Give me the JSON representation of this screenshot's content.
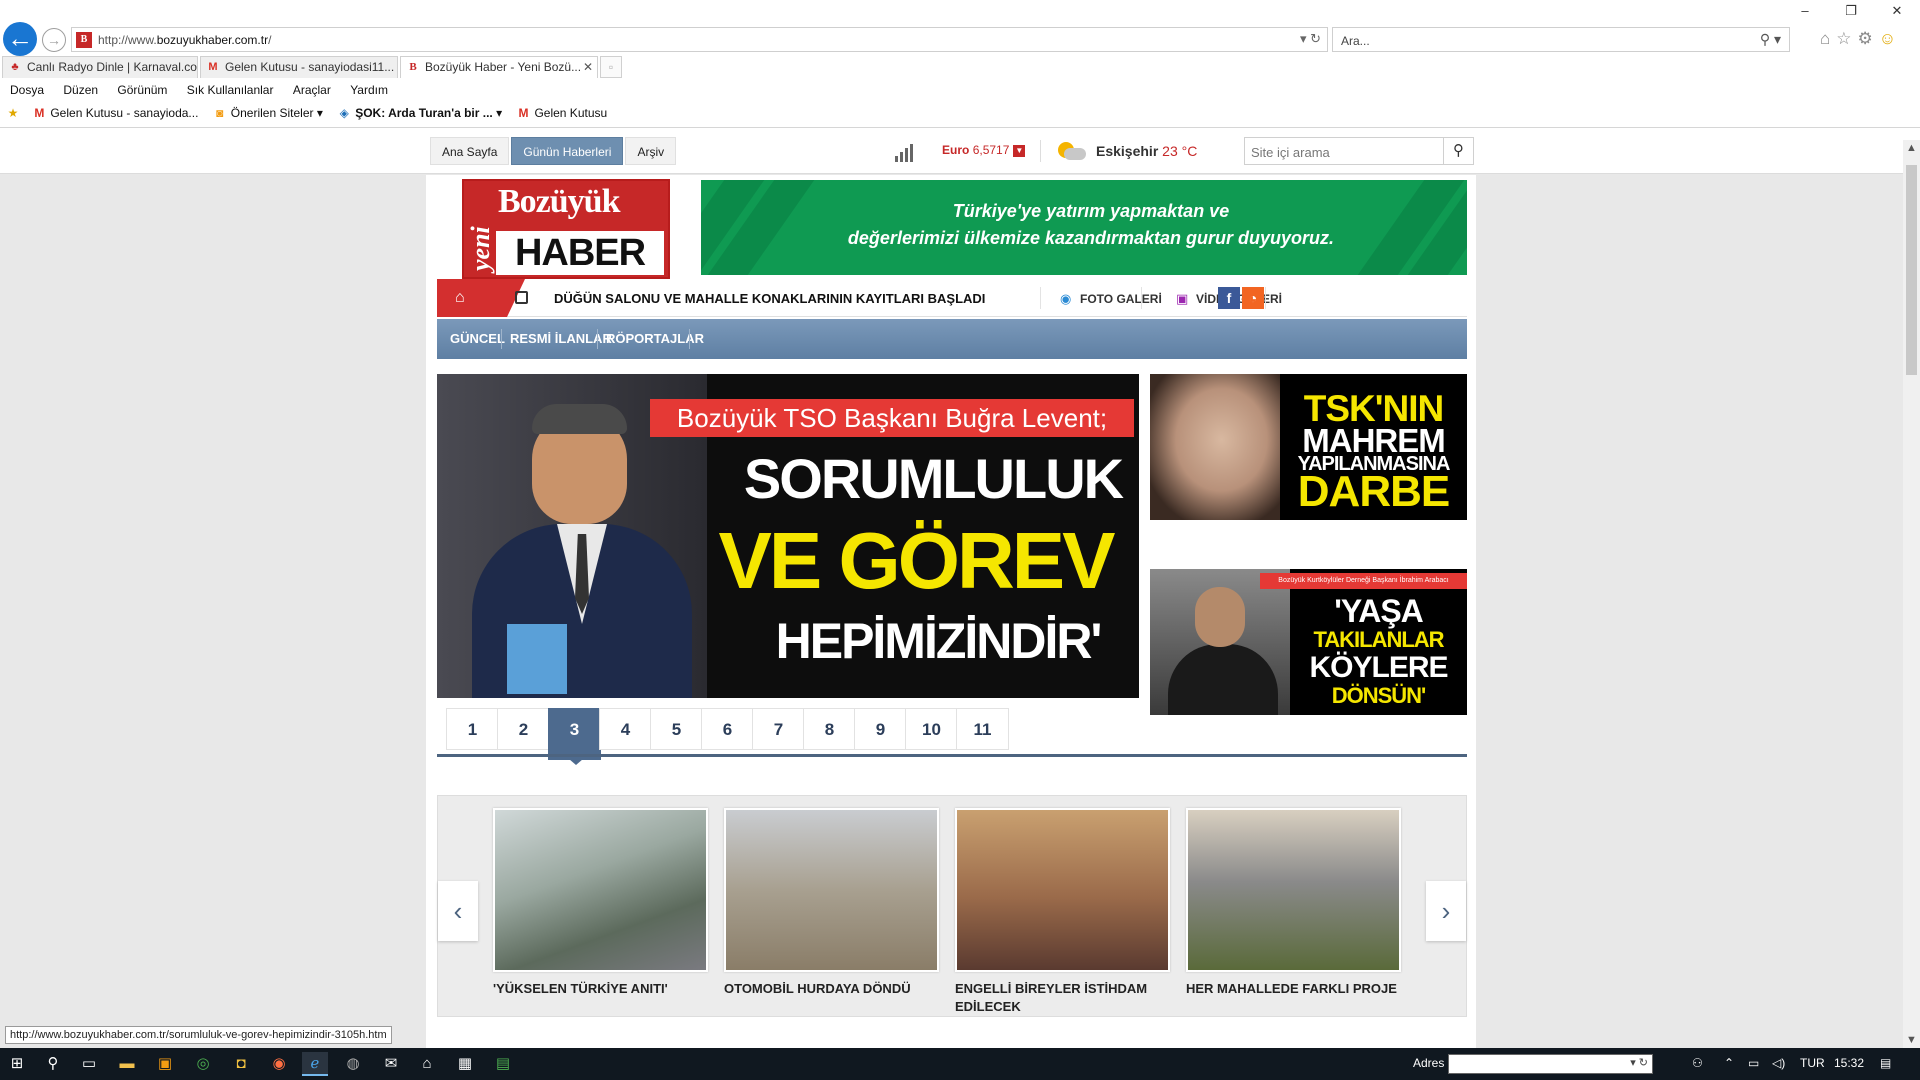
{
  "browser": {
    "url_prefix": "http://www.",
    "url_domain": "bozuyukhaber.com.tr",
    "url_suffix": "/",
    "search_placeholder": "Ara...",
    "tabs": [
      {
        "label": "Canlı Radyo Dinle | Karnaval.co"
      },
      {
        "label": "Gelen Kutusu - sanayiodasi11..."
      },
      {
        "label": "Bozüyük Haber - Yeni Bozü..."
      }
    ],
    "menu": [
      "Dosya",
      "Düzen",
      "Görünüm",
      "Sık Kullanılanlar",
      "Araçlar",
      "Yardım"
    ],
    "favorites": [
      {
        "label": "Gelen Kutusu - sanayioda..."
      },
      {
        "label": "Önerilen Siteler"
      },
      {
        "label": "ŞOK: Arda Turan'a bir ..."
      },
      {
        "label": "Gelen Kutusu"
      }
    ],
    "status_url": "http://www.bozuyukhaber.com.tr/sorumluluk-ve-gorev-hepimizindir-3105h.htm"
  },
  "site": {
    "topnav": [
      "Ana Sayfa",
      "Günün Haberleri",
      "Arşiv"
    ],
    "currency_label": "Euro",
    "currency_value": "6,5717",
    "city": "Eskişehir",
    "temperature": "23 °C",
    "search_placeholder": "Site içi arama",
    "logo_yeni": "yeni",
    "logo_line1": "Bozüyük",
    "logo_line2": "HABER",
    "banner_line1": "Türkiye'ye yatırım yapmaktan ve",
    "banner_line2": "değerlerimizi ülkemize kazandırmaktan gurur duyuyoruz.",
    "ticker": "DÜĞÜN SALONU VE MAHALLE KONAKLARININ KAYITLARI BAŞLADI",
    "photo_gallery": "FOTO GALERİ",
    "video_gallery": "VİDEO GALERİ",
    "categories": [
      "GÜNCEL",
      "RESMİ İLANLAR",
      "RÖPORTAJLAR"
    ],
    "main_slide": {
      "headline": "Bozüyük TSO Başkanı Buğra Levent;",
      "line1": "SORUMLULUK",
      "line2": "VE GÖREV",
      "line3": "HEPİMİZİNDİR'"
    },
    "pages": [
      "1",
      "2",
      "3",
      "4",
      "5",
      "6",
      "7",
      "8",
      "9",
      "10",
      "11"
    ],
    "active_page": "3",
    "side1": {
      "l1": "TSK'NIN",
      "l2": "MAHREM",
      "l3": "YAPILANMASINA",
      "l4": "DARBE"
    },
    "side2": {
      "strip": "Bozüyük Kurtköylüler Derneği Başkanı İbrahim Arabacı",
      "l1": "'YAŞA",
      "l2": "TAKILANLAR",
      "l3": "KÖYLERE",
      "l4": "DÖNSÜN'"
    },
    "carousel": [
      {
        "caption": "'YÜKSELEN TÜRKİYE ANITI'"
      },
      {
        "caption": "OTOMOBİL HURDAYA DÖNDÜ"
      },
      {
        "caption": "ENGELLİ BİREYLER İSTİHDAM EDİLECEK"
      },
      {
        "caption": "HER MAHALLEDE FARKLI PROJE"
      }
    ]
  },
  "taskbar": {
    "address_label": "Adres",
    "language": "TUR",
    "time": "15:32"
  }
}
